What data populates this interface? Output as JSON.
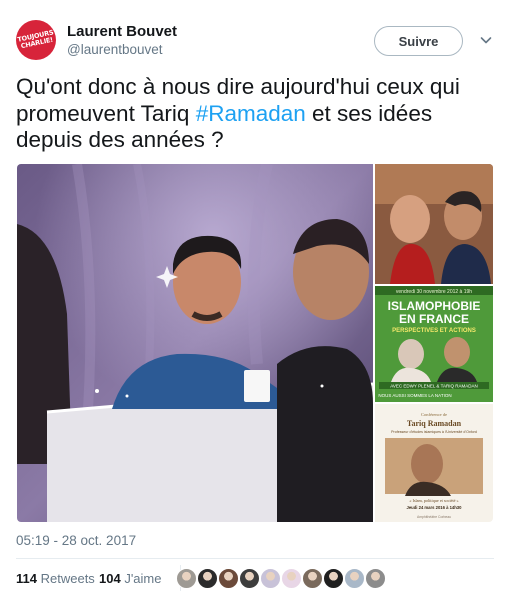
{
  "tweet": {
    "author": {
      "name": "Laurent Bouvet",
      "handle": "@laurentbouvet",
      "avatar_text": [
        "TOUJOURS",
        "CHARLIE!"
      ],
      "avatar_color": "#d7243a"
    },
    "follow_label": "Suivre",
    "text_before": "Qu'ont donc à nous dire aujourd'hui ceux qui promeuvent Tariq ",
    "hashtag": "#Ramadan",
    "text_after": " et ses idées depuis des années ?",
    "hashtag_color": "#1da1f2",
    "timestamp": "05:19 - 28 oct. 2017"
  },
  "media": {
    "poster": {
      "header_line": "vendredi 30 novembre 2012 à 19h",
      "title_line1": "ISLAMOPHOBIE",
      "title_line2": "EN FRANCE",
      "subtitle": "PERSPECTIVES ET ACTIONS",
      "banner": "AVEC EDWY PLENEL & TARIQ RAMADAN",
      "footer": "NOUS AUSSI SOMMES LA NATION"
    },
    "flyer": {
      "label": "Conférence de",
      "name": "Tariq Ramadan",
      "role": "Professeur d'études islamiques à l'Université d'Oxford",
      "topic": "« Islam, politique et société »",
      "date": "Jeudi 24 mars 2016 à 14h30",
      "place": "Amphithéâtre Corbeau"
    }
  },
  "stats": {
    "retweets_count": "114",
    "retweets_label": "Retweets",
    "likes_count": "104",
    "likes_label": "J'aime"
  },
  "likers": [
    {
      "icon": "liker-avatar-1",
      "color": "#9e9a94"
    },
    {
      "icon": "liker-avatar-2",
      "color": "#2b2b2b"
    },
    {
      "icon": "liker-avatar-3",
      "color": "#6b4a3a"
    },
    {
      "icon": "liker-avatar-4",
      "color": "#3d3d3d"
    },
    {
      "icon": "liker-avatar-5",
      "color": "#c8c2d8"
    },
    {
      "icon": "liker-avatar-6",
      "color": "#e8d6e6"
    },
    {
      "icon": "liker-avatar-7",
      "color": "#7a6a5c"
    },
    {
      "icon": "liker-avatar-8",
      "color": "#1f1f1f"
    },
    {
      "icon": "liker-avatar-9",
      "color": "#a9b8c8"
    },
    {
      "icon": "liker-avatar-10",
      "color": "#8c8c8c"
    }
  ]
}
